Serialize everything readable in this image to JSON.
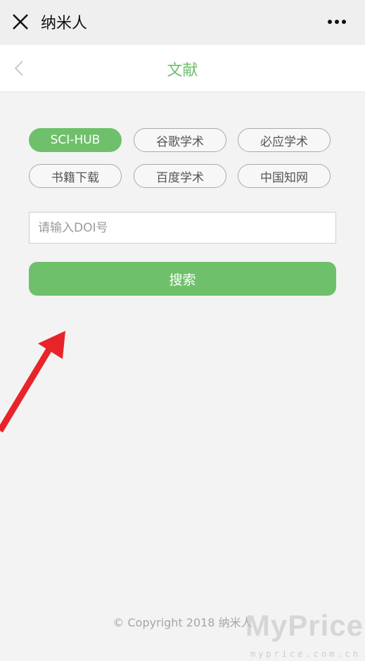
{
  "topbar": {
    "title": "纳米人",
    "close_icon": "close-icon",
    "more_icon": "more-dots-icon"
  },
  "header": {
    "title": "文献",
    "back_icon": "chevron-left-icon"
  },
  "chips": [
    {
      "label": "SCI-HUB",
      "active": true
    },
    {
      "label": "谷歌学术",
      "active": false
    },
    {
      "label": "必应学术",
      "active": false
    },
    {
      "label": "书籍下载",
      "active": false
    },
    {
      "label": "百度学术",
      "active": false
    },
    {
      "label": "中国知网",
      "active": false
    }
  ],
  "search": {
    "placeholder": "请输入DOI号",
    "value": "",
    "button_label": "搜索"
  },
  "footer": {
    "copyright": "© Copyright 2018 纳米人"
  },
  "watermark": {
    "text": "MyPrice",
    "sub": "myprice.com.cn"
  },
  "colors": {
    "accent": "#6ec06a",
    "arrow": "#e8232a"
  }
}
